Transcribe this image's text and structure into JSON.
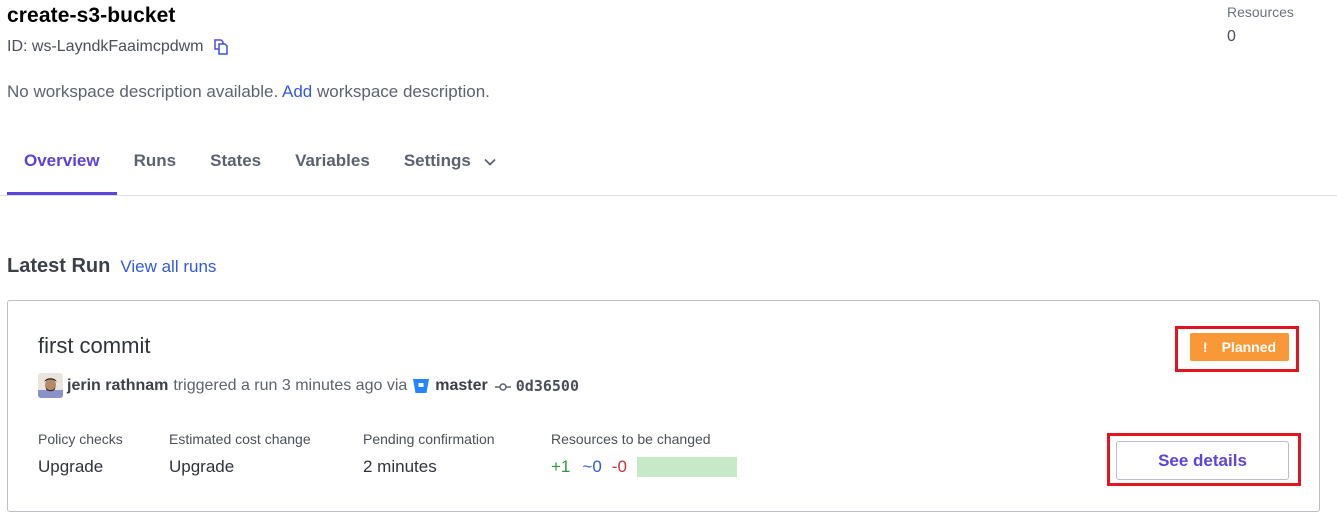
{
  "workspace": {
    "name": "create-s3-bucket",
    "id_label": "ID: ws-LayndkFaaimcpdwm",
    "description_prefix": "No workspace description available.",
    "description_link": "Add",
    "description_suffix": "workspace description.",
    "copy_icon": "copy-icon"
  },
  "resources": {
    "label": "Resources",
    "value": "0"
  },
  "tabs": [
    {
      "label": "Overview",
      "active": true
    },
    {
      "label": "Runs",
      "active": false
    },
    {
      "label": "States",
      "active": false
    },
    {
      "label": "Variables",
      "active": false
    },
    {
      "label": "Settings",
      "active": false,
      "icon": "chevron-down-icon"
    }
  ],
  "latest_run": {
    "heading": "Latest Run",
    "view_all_label": "View all runs",
    "commit_message": "first commit",
    "user": "jerin rathnam",
    "trigger_text": "triggered a run 3 minutes ago via",
    "repo_icon": "bitbucket-icon",
    "branch": "master",
    "commit_icon": "git-commit-icon",
    "commit_sha": "0d36500",
    "status": {
      "label": "Planned",
      "icon": "exclamation-icon",
      "color": "#f89837"
    },
    "stats": [
      {
        "label": "Policy checks",
        "value": "Upgrade"
      },
      {
        "label": "Estimated cost change",
        "value": "Upgrade"
      },
      {
        "label": "Pending confirmation",
        "value": "2 minutes"
      }
    ],
    "resources_changed": {
      "label": "Resources to be changed",
      "add": "+1",
      "change": "~0",
      "destroy": "-0",
      "add_color": "#2e9b3a",
      "change_color": "#3458e0",
      "destroy_color": "#d0303c"
    },
    "see_details_label": "See details"
  },
  "colors": {
    "accent": "#5a44d9",
    "link": "#3458e0",
    "highlight": "#e3141f"
  }
}
